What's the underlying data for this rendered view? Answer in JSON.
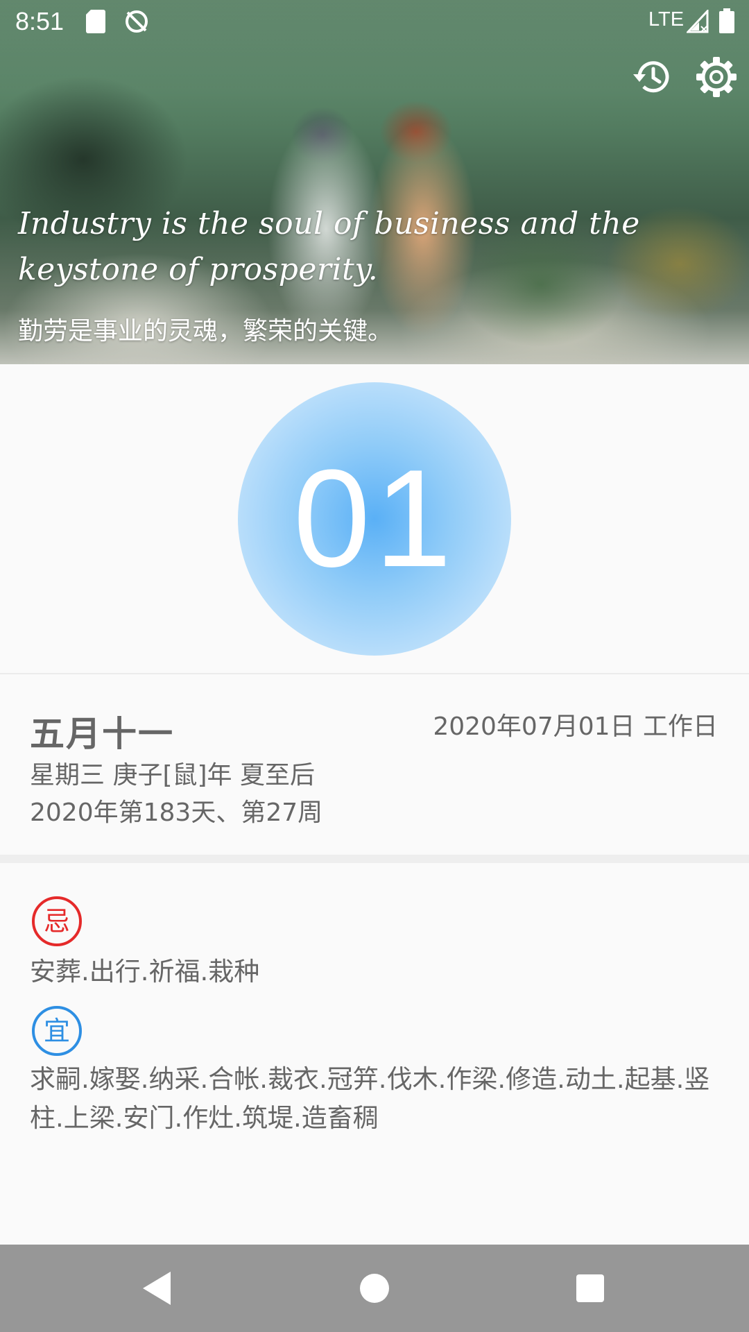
{
  "status_bar": {
    "time": "8:51",
    "network": "LTE",
    "icons": [
      "sd-card-icon",
      "sync-disabled-icon",
      "signal-icon",
      "battery-icon"
    ]
  },
  "toolbar": {
    "icons": [
      "history-icon",
      "settings-icon"
    ]
  },
  "quote": {
    "english": "Industry is the soul of business and the keystone of prosperity.",
    "chinese": "勤劳是事业的灵魂，繁荣的关键。"
  },
  "day": {
    "number": "01",
    "circle_color": "#5ab0f6"
  },
  "date_info": {
    "lunar": "五月十一",
    "gregorian": "2020年07月01日 工作日",
    "weekday_line": "星期三 庚子[鼠]年 夏至后",
    "day_of_year_line": "2020年第183天、第27周"
  },
  "almanac": {
    "ji_label": "忌",
    "ji_color": "#e52a2a",
    "ji_items": "安葬.出行.祈福.栽种",
    "yi_label": "宜",
    "yi_color": "#2e8fe3",
    "yi_items": "求嗣.嫁娶.纳采.合帐.裁衣.冠笄.伐木.作梁.修造.动土.起基.竖柱.上梁.安门.作灶.筑堤.造畜稠"
  },
  "nav_bar": {
    "buttons": [
      "back-button",
      "home-button",
      "recents-button"
    ]
  }
}
